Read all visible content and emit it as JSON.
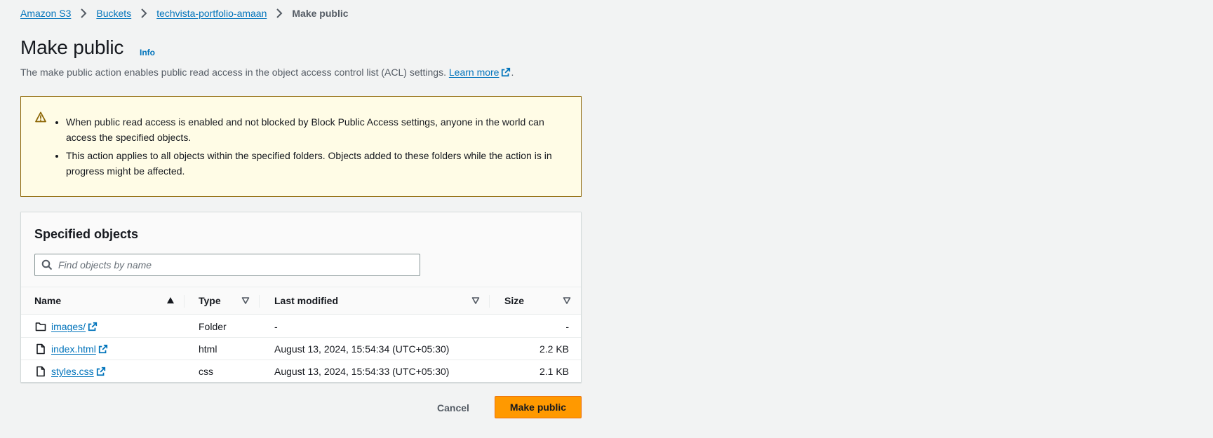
{
  "breadcrumb": {
    "items": [
      "Amazon S3",
      "Buckets",
      "techvista-portfolio-amaan"
    ],
    "current": "Make public"
  },
  "header": {
    "title": "Make public",
    "info": "Info",
    "description": "The make public action enables public read access in the object access control list (ACL) settings.",
    "learn_more": "Learn more",
    "period": "."
  },
  "warning": {
    "icon": "warning-icon",
    "items": [
      "When public read access is enabled and not blocked by Block Public Access settings, anyone in the world can access the specified objects.",
      "This action applies to all objects within the specified folders. Objects added to these folders while the action is in progress might be affected."
    ]
  },
  "objects": {
    "title": "Specified objects",
    "search_placeholder": "Find objects by name",
    "columns": {
      "name": "Name",
      "type": "Type",
      "last_modified": "Last modified",
      "size": "Size"
    },
    "rows": [
      {
        "icon": "folder-icon",
        "name": "images/",
        "type": "Folder",
        "modified": "-",
        "size": "-"
      },
      {
        "icon": "file-icon",
        "name": "index.html",
        "type": "html",
        "modified": "August 13, 2024, 15:54:34 (UTC+05:30)",
        "size": "2.2 KB"
      },
      {
        "icon": "file-icon",
        "name": "styles.css",
        "type": "css",
        "modified": "August 13, 2024, 15:54:33 (UTC+05:30)",
        "size": "2.1 KB"
      }
    ]
  },
  "actions": {
    "cancel": "Cancel",
    "submit": "Make public"
  },
  "colors": {
    "link": "#0073bb",
    "primary_button": "#ff9900",
    "warning_bg": "#fffce6",
    "warning_border": "#8d6605",
    "page_bg": "#f2f3f3"
  }
}
